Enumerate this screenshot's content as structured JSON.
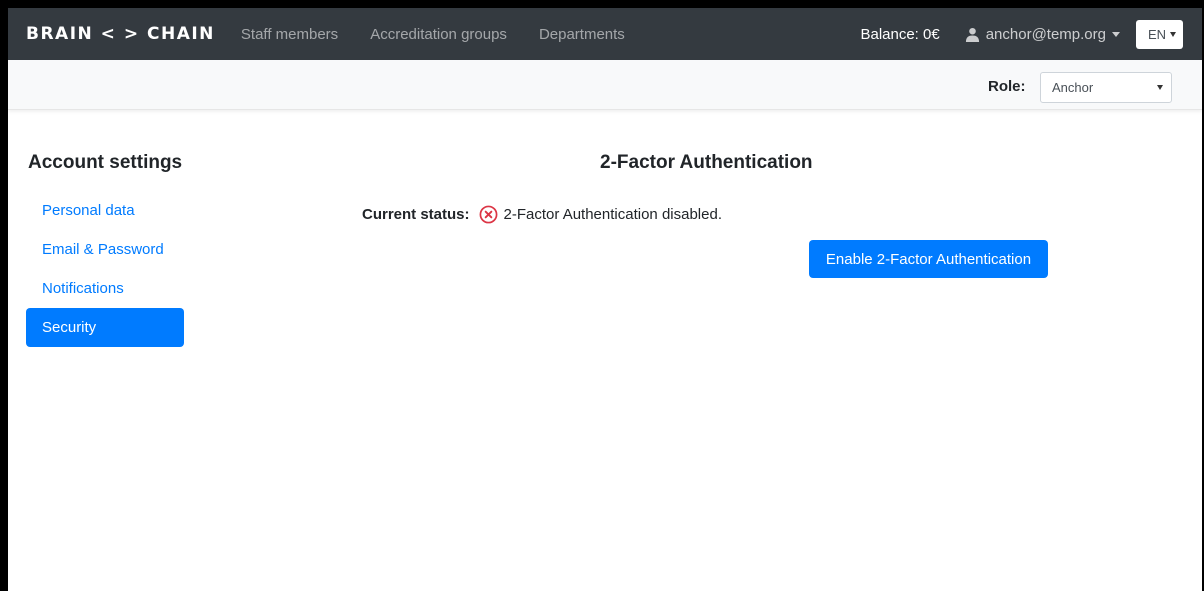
{
  "navbar": {
    "brand": "BRAIN < > CHAIN",
    "links": [
      "Staff members",
      "Accreditation groups",
      "Departments"
    ],
    "balance": "Balance: 0€",
    "user_email": "anchor@temp.org",
    "language": "EN"
  },
  "rolebar": {
    "label": "Role:",
    "selected": "Anchor"
  },
  "sidebar": {
    "title": "Account settings",
    "items": [
      {
        "label": "Personal data"
      },
      {
        "label": "Email & Password"
      },
      {
        "label": "Notifications"
      },
      {
        "label": "Security"
      }
    ],
    "active_item": "Security"
  },
  "main": {
    "title": "2-Factor Authentication",
    "status_label": "Current status:",
    "status_text": "2-Factor Authentication disabled.",
    "enable_button": "Enable 2-Factor Authentication"
  },
  "colors": {
    "navbar_bg": "#343a40",
    "primary": "#007bff",
    "danger": "#dc3545"
  },
  "icons": {
    "user": "user-icon",
    "status": "error-circle-x-icon"
  }
}
